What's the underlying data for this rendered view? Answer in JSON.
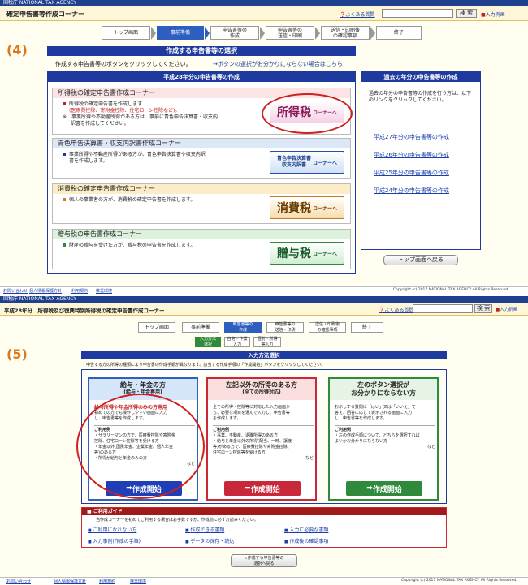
{
  "p4": {
    "agency": "国税庁  NATIONAL TAX AGENCY",
    "title": "確定申告書等作成コーナー",
    "faq": "よくある質問",
    "search_btn": "検 索",
    "input_example": "入力例画",
    "steps": [
      "トップ画面",
      "事前準備",
      "申告書等の\n作成",
      "申告書等の\n送信・印刷",
      "送信・印刷後\nの確認事項",
      "終了"
    ],
    "label": "(4)",
    "heading": "作成する申告書等の選択",
    "instruction": "作成する申告書等のボタンをクリックしてください。",
    "help_link": "→ボタンの選択がお分かりにならない場合はこちら",
    "main_head": "平成28年分の申告書等の作成",
    "sections": [
      {
        "title": "所得税の確定申告書作成コーナー",
        "l1": "所得税の確定申告書を作成します",
        "l2": "(医療費控除、寄附金控除、住宅ローン控除など)。",
        "l3": "※　事業所得や不動産所得がある方は、事前に青色申告決算書・収支内",
        "l4": "訳書を作成してください。",
        "btn": "所得税",
        "btn_sub": "コーナーへ"
      },
      {
        "title": "青色申告決算書・収支内訳書作成コーナー",
        "l1": "事業所得や不動産所得がある方が、青色申告決算書や収支内訳",
        "l2": "書を作成します。",
        "btn": "青色申告決算書\n収支内訳書",
        "btn_sub": "コーナーへ"
      },
      {
        "title": "消費税の確定申告書作成コーナー",
        "l1": "個人の事業者の方が、消費税の確定申告書を作成します。",
        "btn": "消費税",
        "btn_sub": "コーナーへ"
      },
      {
        "title": "贈与税の申告書作成コーナー",
        "l1": "財産の贈与を受けた方が、贈与税の申告書を作成します。",
        "btn": "贈与税",
        "btn_sub": "コーナーへ"
      }
    ],
    "past_head": "過去の年分の申告書等の作成",
    "past_desc": "過去の年分の申告書等の作成を行う方は、以下のリンクをクリックしてください。",
    "past_links": [
      "平成27年分の申告書等の作成",
      "平成26年分の申告書等の作成",
      "平成25年分の申告書等の作成",
      "平成24年分の申告書等の作成"
    ],
    "back_top": "トップ画面へ戻る",
    "footer_links": [
      "お問い合わせ",
      "個人情報保護方針",
      "利用規約",
      "推奨環境"
    ],
    "copyright": "Copyright (c) 2017 NATIONAL TAX AGENCY All Rights Reserved."
  },
  "p5": {
    "agency": "国税庁  NATIONAL TAX AGENCY",
    "title": "平成28年分　所得税及び復興特別所得税の確定申告書作成コーナー",
    "faq": "よくある質問",
    "search_btn": "検 索",
    "input_example": "入力例画",
    "steps": [
      "トップ画面",
      "事前準備",
      "申告書等の\n作成",
      "申告書等の\n送信・印刷",
      "送信・印刷後\nの確認事項",
      "終了"
    ],
    "substeps": [
      "入力方法\n選択",
      "自宅・作業\n入力",
      "個別・所得\n等入力"
    ],
    "label": "(5)",
    "heading": "入力方法選択",
    "instruction": "申告する方の所得の種類により申告書の作成手順が異なります。該当する作成手順の「作成開始」ボタンをクリックしてください。",
    "cards": [
      {
        "title": "給与・年金の方",
        "sub": "(給与・年金専用)",
        "emph": "給与所得や年金所得のみの方専用",
        "d1": "初めての方でも操作しやすい画面に入力",
        "d2": "し、申告書等を作成します。",
        "cond": "ご利用例",
        "c1": "・サラリーマンの方で、医療費控除や寄附金",
        "c2": " 控除、住宅ローン控除等を受ける方",
        "c3": "・年金以外(国民年金、企業年金、個人年金",
        "c4": " 等)のある方",
        "c5": "・所得が給与と年金のみの方",
        "etc": "など",
        "btn": "作成開始"
      },
      {
        "title": "左記以外の所得のある方",
        "sub": "(全ての所得対応)",
        "d1": "全ての所得・控除等に対応した入力画面か",
        "d2": "ら、必要な項目を選んで入力し、申告書等",
        "d3": "を作成します。",
        "cond": "ご利用例",
        "c1": "・事業、不動産、退職所得のある方",
        "c2": "・給与と年金以外の所得(配当、一時、譲渡",
        "c3": " 等)がある方で、医療費控除や寄附金控除、",
        "c4": " 住宅ローン控除等を受ける方",
        "etc": "など",
        "btn": "作成開始"
      },
      {
        "title": "左のボタン選択が",
        "sub": "お分かりにならない方",
        "d1": "お示しする質問に「はい」又は「いいえ」で",
        "d2": "答え、回答に応じて表示される画面に入力",
        "d3": "し、申告書等を作成します。",
        "cond": "ご利用例",
        "c1": "・左の作成手順について、どちらを選択すれば",
        "c2": " よいかお分かりにならない方",
        "etc": "など",
        "btn": "作成開始"
      }
    ],
    "guide_head": "ご利用ガイド",
    "guide_desc": "当作成コーナーを初めてご利用する場合はお手数ですが、作成前に必ずお読みください。",
    "guide_links": [
      "ご利用になれない方",
      "作成できる書類",
      "入力に必要な書類",
      "入力事例(作成の手順)",
      "データの保存・読込",
      "作成後の確認事項"
    ],
    "back_btn": "<作成する申告書等の\n選択へ戻る",
    "footer_links": [
      "お問い合わせ",
      "個人情報保護方針",
      "利用規約",
      "推奨環境"
    ],
    "copyright": "Copyright (c) 2017 NATIONAL TAX AGENCY All Rights Reserved."
  },
  "colors": {
    "accent": "#1f3a9e",
    "orange": "#d97a20",
    "red_oval": "#d02020",
    "start_blue": "#1f3fb8",
    "start_red": "#c8283a",
    "start_green": "#2f8a3c"
  }
}
